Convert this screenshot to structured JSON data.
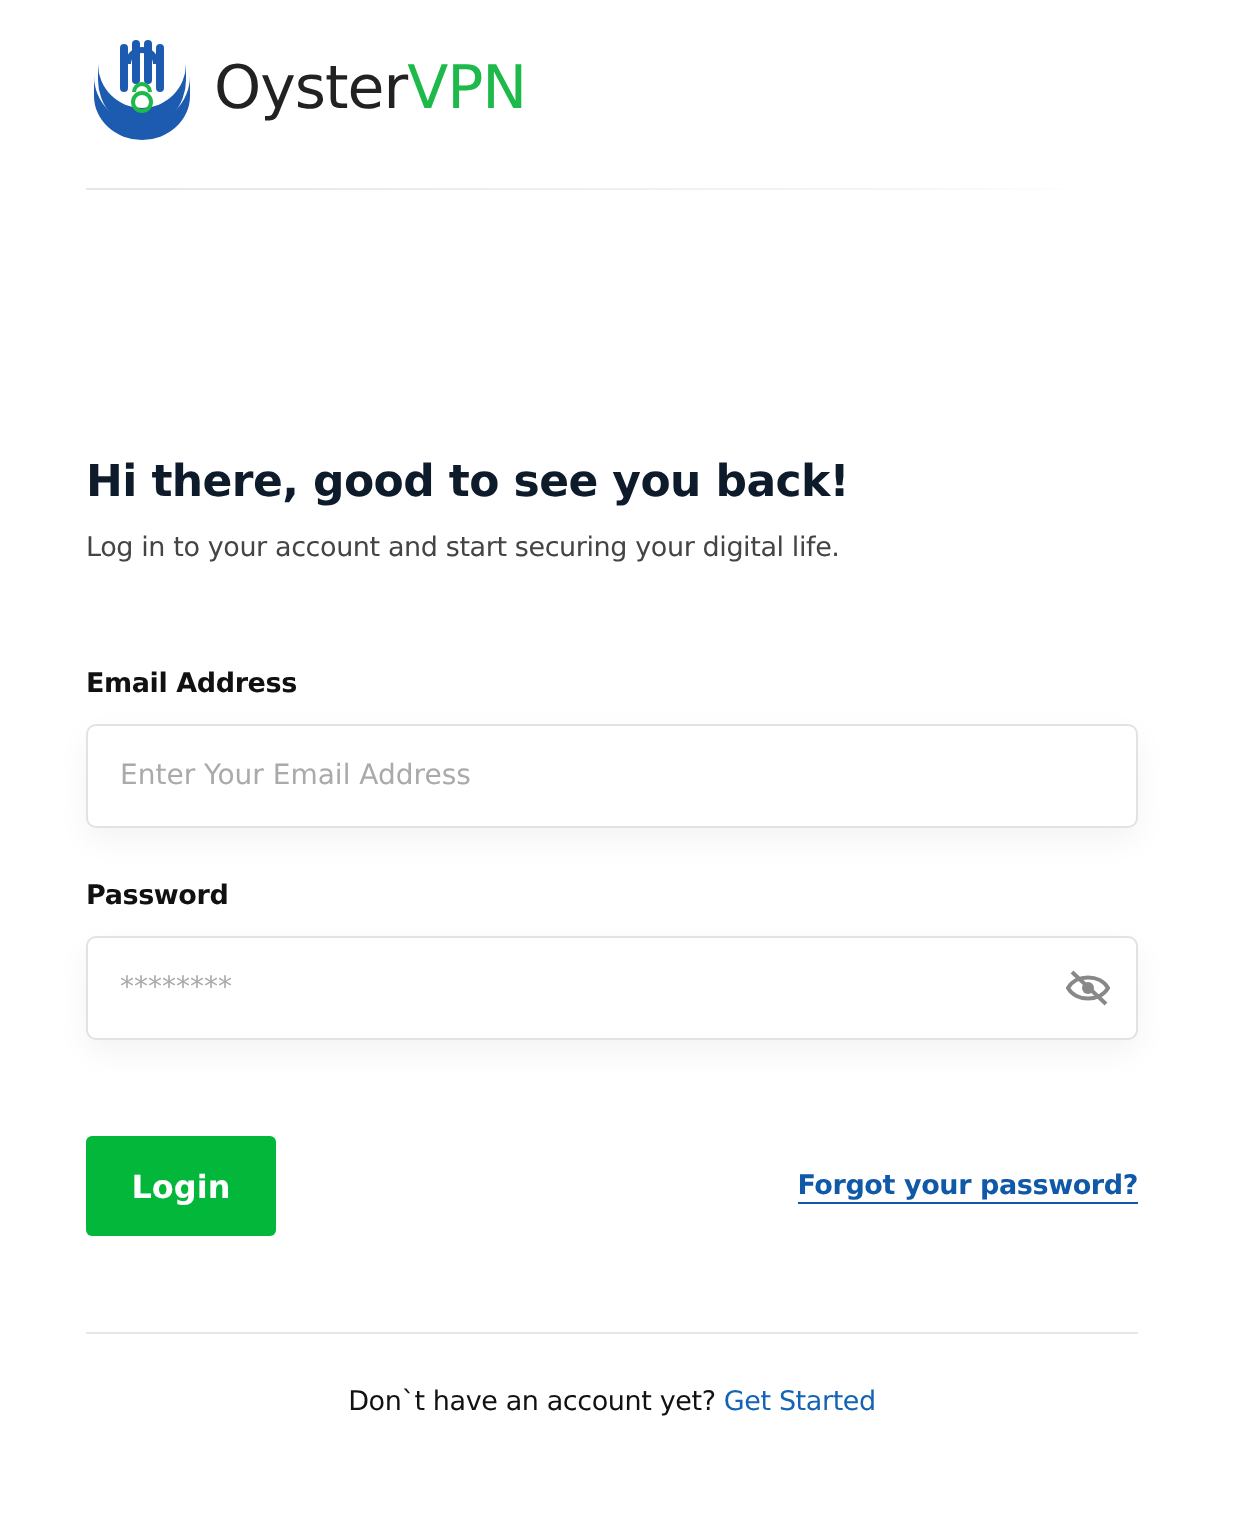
{
  "logo": {
    "name": "Oyster",
    "accent": "VPN"
  },
  "heading": "Hi there, good to see you back!",
  "subtitle": "Log in to your account and start securing your digital life.",
  "fields": [
    {
      "label": "Email Address",
      "placeholder": "Enter Your Email Address",
      "kind": "email"
    },
    {
      "label": "Password",
      "placeholder": "********",
      "kind": "password"
    }
  ],
  "login_button": "Login",
  "forgot_link": "Forgot your password?",
  "footer": {
    "text": "Don`t have an account yet?",
    "link": "Get Started"
  }
}
